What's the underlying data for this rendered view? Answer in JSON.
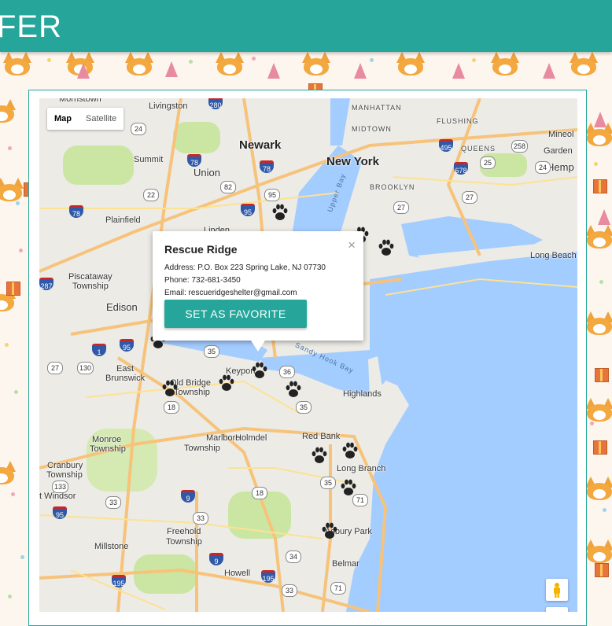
{
  "header": {
    "title": "FER"
  },
  "map": {
    "type_control": {
      "map_label": "Map",
      "satellite_label": "Satellite"
    },
    "places": [
      {
        "name": "Morristown",
        "cls": ""
      },
      {
        "name": "Livingston",
        "cls": ""
      },
      {
        "name": "MANHATTAN",
        "cls": "small-caps"
      },
      {
        "name": "MIDTOWN",
        "cls": "small-caps"
      },
      {
        "name": "FLUSHING",
        "cls": "small-caps"
      },
      {
        "name": "Mineol",
        "cls": ""
      },
      {
        "name": "Newark",
        "cls": "big"
      },
      {
        "name": "New York",
        "cls": "big"
      },
      {
        "name": "QUEENS",
        "cls": "small-caps"
      },
      {
        "name": "Garden",
        "cls": ""
      },
      {
        "name": "Summit",
        "cls": ""
      },
      {
        "name": "Union",
        "cls": "mid"
      },
      {
        "name": "BROOKLYN",
        "cls": "small-caps"
      },
      {
        "name": "Hemp",
        "cls": "mid"
      },
      {
        "name": "Plainfield",
        "cls": ""
      },
      {
        "name": "Linden",
        "cls": ""
      },
      {
        "name": "Upper Bay",
        "cls": "water"
      },
      {
        "name": "Long Beach",
        "cls": ""
      },
      {
        "name": "Piscataway",
        "cls": ""
      },
      {
        "name": "Township",
        "cls": ""
      },
      {
        "name": "Edison",
        "cls": "mid"
      },
      {
        "name": "Sandy Hook Bay",
        "cls": "water"
      },
      {
        "name": "East",
        "cls": ""
      },
      {
        "name": "Brunswick",
        "cls": ""
      },
      {
        "name": "Old Bridge",
        "cls": ""
      },
      {
        "name": "Township",
        "cls": ""
      },
      {
        "name": "Keyport",
        "cls": ""
      },
      {
        "name": "Highlands",
        "cls": ""
      },
      {
        "name": "Monroe",
        "cls": ""
      },
      {
        "name": "Township",
        "cls": ""
      },
      {
        "name": "Marlboro",
        "cls": ""
      },
      {
        "name": "Township",
        "cls": ""
      },
      {
        "name": "Holmdel",
        "cls": ""
      },
      {
        "name": "Red Bank",
        "cls": ""
      },
      {
        "name": "Long Branch",
        "cls": ""
      },
      {
        "name": "Cranbury",
        "cls": ""
      },
      {
        "name": "Township",
        "cls": ""
      },
      {
        "name": "t Windsor",
        "cls": ""
      },
      {
        "name": "Freehold",
        "cls": ""
      },
      {
        "name": "Township",
        "cls": ""
      },
      {
        "name": "Asbury Park",
        "cls": ""
      },
      {
        "name": "Millstone",
        "cls": ""
      },
      {
        "name": "Belmar",
        "cls": ""
      },
      {
        "name": "Howell",
        "cls": ""
      }
    ],
    "route_shields": [
      "280",
      "24",
      "95",
      "495",
      "258",
      "78",
      "78",
      "678",
      "25",
      "24",
      "82",
      "22",
      "95",
      "27",
      "27",
      "78",
      "287",
      "1",
      "95",
      "27",
      "130",
      "35",
      "36",
      "18",
      "35",
      "9",
      "18",
      "35",
      "133",
      "33",
      "33",
      "71",
      "95",
      "33",
      "9",
      "34",
      "195",
      "195",
      "71"
    ]
  },
  "info_window": {
    "title": "Rescue Ridge",
    "close_symbol": "×",
    "address": "Address: P.O. Box 223 Spring Lake, NJ 07730",
    "phone": "Phone: 732-681-3450",
    "email": "Email: rescueridgeshelter@gmail.com",
    "button_label": "SET AS FAVORITE"
  },
  "colors": {
    "accent": "#26a69a",
    "water": "#a3ccff",
    "land": "#ecebe6"
  }
}
